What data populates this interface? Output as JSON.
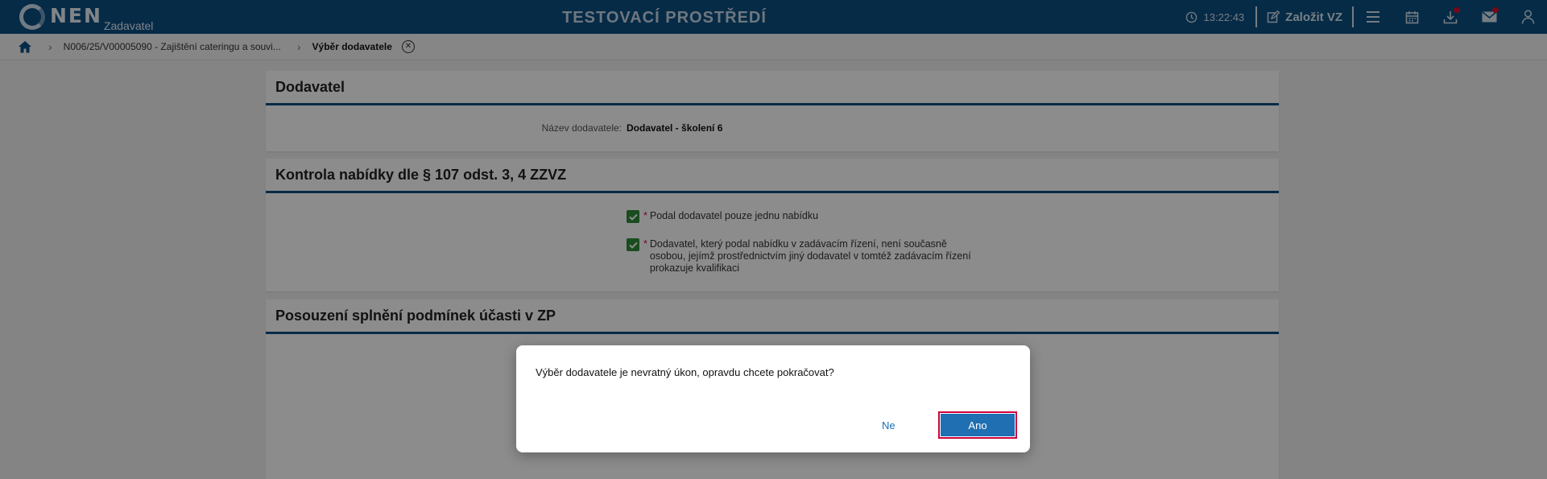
{
  "header": {
    "logo_text": "NEN",
    "logo_sub": "Zadavatel",
    "env_title": "TESTOVACÍ PROSTŘEDÍ",
    "time": "13:22:43",
    "new_vz_label": "Založit VZ"
  },
  "breadcrumb": {
    "item1": "N006/25/V00005090 - Zajištění cateringu a souvi...",
    "current": "Výběr dodavatele"
  },
  "section_dodavatel": {
    "title": "Dodavatel",
    "name_label": "Název dodavatele:",
    "name_value": "Dodavatel - školení 6"
  },
  "section_kontrola": {
    "title": "Kontrola nabídky dle § 107 odst. 3, 4 ZZVZ",
    "checks": [
      {
        "text": "Podal dodavatel pouze jednu nabídku",
        "checked": true
      },
      {
        "text": "Dodavatel, který podal nabídku v zadávacím řízení, není současně osobou, jejímž prostřednictvím jiný dodavatel v tomtéž zadávacím řízení prokazuje kvalifikaci",
        "checked": true
      }
    ],
    "required_mark": "*"
  },
  "section_posouzeni": {
    "title": "Posouzení splnění podmínek účasti v ZP"
  },
  "dialog": {
    "message": "Výběr dodavatele je nevratný úkon, opravdu chcete pokračovat?",
    "no_label": "Ne",
    "yes_label": "Ano"
  },
  "colors": {
    "header_bg": "#0b4f82",
    "accent": "#1f6fb2",
    "check_green": "#2e8b3a",
    "notification_red": "#d3102f"
  }
}
